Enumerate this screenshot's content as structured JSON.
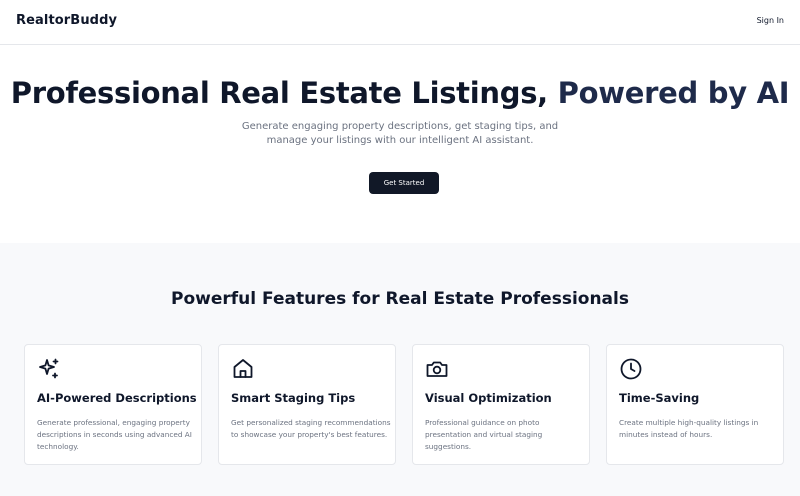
{
  "header": {
    "brand": "RealtorBuddy",
    "signin_label": "Sign In"
  },
  "hero": {
    "title_main": "Professional Real Estate Listings, ",
    "title_accent": "Powered by AI",
    "subtitle": "Generate engaging property descriptions, get staging tips, and manage your listings with our intelligent AI assistant.",
    "cta_label": "Get Started"
  },
  "features": {
    "title": "Powerful Features for Real Estate Professionals",
    "cards": [
      {
        "icon": "sparkles-icon",
        "title": "AI-Powered Descriptions",
        "description": "Generate professional, engaging property descriptions in seconds using advanced AI technology."
      },
      {
        "icon": "home-icon",
        "title": "Smart Staging Tips",
        "description": "Get personalized staging recommendations to showcase your property's best features."
      },
      {
        "icon": "camera-icon",
        "title": "Visual Optimization",
        "description": "Professional guidance on photo presentation and virtual staging suggestions."
      },
      {
        "icon": "clock-icon",
        "title": "Time-Saving",
        "description": "Create multiple high-quality listings in minutes instead of hours."
      }
    ]
  },
  "colors": {
    "primary": "#111827",
    "text": "#0f172a",
    "muted": "#6b7280",
    "section_bg": "#f8f9fb",
    "border": "#e5e7eb"
  }
}
